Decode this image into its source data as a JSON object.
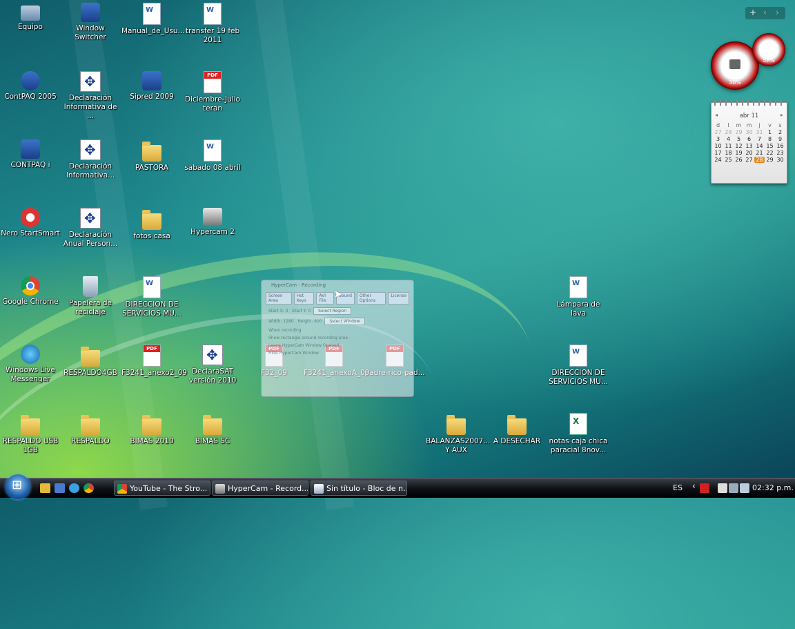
{
  "desktop": {
    "icons": [
      {
        "label": "Equipo",
        "icon": "computer-icon"
      },
      {
        "label": "Window Switcher",
        "icon": "window-switcher-icon"
      },
      {
        "label": "Manual_de_Usu...",
        "icon": "word-document-icon"
      },
      {
        "label": "transfer 19 feb 2011",
        "icon": "word-document-icon"
      },
      {
        "label": "ContPAQ 2005",
        "icon": "contpaq-icon"
      },
      {
        "label": "Declaración Informativa de ...",
        "icon": "sat-app-icon"
      },
      {
        "label": "Sipred 2009",
        "icon": "sipred-icon"
      },
      {
        "label": "Diciembre-Julio teran",
        "icon": "pdf-document-icon"
      },
      {
        "label": "CONTPAQ i",
        "icon": "contpaq-i-icon"
      },
      {
        "label": "Declaración Informativa...",
        "icon": "sat-app-icon"
      },
      {
        "label": "PASTORA",
        "icon": "folder-icon"
      },
      {
        "label": "sabado 08 abril",
        "icon": "word-document-icon"
      },
      {
        "label": "Nero StartSmart",
        "icon": "nero-icon"
      },
      {
        "label": "Declaración Anual Person...",
        "icon": "sat-app-icon"
      },
      {
        "label": "fotos casa",
        "icon": "folder-icon"
      },
      {
        "label": "Hypercam 2",
        "icon": "hypercam-icon"
      },
      {
        "label": "Google Chrome",
        "icon": "chrome-icon"
      },
      {
        "label": "Papelera de reciclaje",
        "icon": "recycle-bin-icon"
      },
      {
        "label": "DIRECCION DE SERVICIOS MU...",
        "icon": "word-document-icon"
      },
      {
        "label": "Lámpara de lava",
        "icon": "word-document-icon"
      },
      {
        "label": "Windows Live Messenger",
        "icon": "messenger-icon"
      },
      {
        "label": "RESPALDO4GB",
        "icon": "folder-icon"
      },
      {
        "label": "F3241_anexo2_09",
        "icon": "pdf-document-icon"
      },
      {
        "label": "DeclaraSAT versión 2010",
        "icon": "sat-app-icon"
      },
      {
        "label": "F32_09",
        "icon": "pdf-document-icon"
      },
      {
        "label": "F3241_anexoA_09",
        "icon": "pdf-document-icon"
      },
      {
        "label": "padre-rico-pad...",
        "icon": "pdf-document-icon"
      },
      {
        "label": "DIRECCION DE SERVICIOS MU...",
        "icon": "word-document-icon"
      },
      {
        "label": "RESPALDO USB 1GB",
        "icon": "folder-icon"
      },
      {
        "label": "RESPALDO",
        "icon": "folder-icon"
      },
      {
        "label": "BIMAS 2010",
        "icon": "folder-icon"
      },
      {
        "label": "BIMAS SC",
        "icon": "folder-icon"
      },
      {
        "label": "BALANZAS2007... Y AUX",
        "icon": "folder-icon"
      },
      {
        "label": "A DESECHAR",
        "icon": "folder-icon"
      },
      {
        "label": "notas caja chica paracial 8nov...",
        "icon": "excel-document-icon"
      }
    ]
  },
  "gadgets": {
    "add_label": "+",
    "cpu_meter": {
      "cpu": "30%",
      "memory": "57%"
    },
    "calendar": {
      "month": "abr 11",
      "weekdays": [
        "d",
        "l",
        "m",
        "m",
        "j",
        "v",
        "s"
      ],
      "weeks": [
        [
          "27",
          "28",
          "29",
          "30",
          "31",
          "1",
          "2"
        ],
        [
          "3",
          "4",
          "5",
          "6",
          "7",
          "8",
          "9"
        ],
        [
          "10",
          "11",
          "12",
          "13",
          "14",
          "15",
          "16"
        ],
        [
          "17",
          "18",
          "19",
          "20",
          "21",
          "22",
          "23"
        ],
        [
          "24",
          "25",
          "26",
          "27",
          "28",
          "29",
          "30"
        ]
      ],
      "today": "28"
    }
  },
  "hypercam_window": {
    "title": "HyperCam - Recording",
    "tabs": [
      "Screen Area",
      "Hot Keys",
      "AVI File",
      "Sound",
      "Other Options",
      "License"
    ],
    "startx_label": "Start X: 0",
    "starty_label": "Start Y: 0",
    "width_label": "Width: 1280",
    "height_label": "Height: 800",
    "select_region": "Select Region",
    "select_window": "Select Window",
    "when_recording": "When recording",
    "opt1": "Show rectangle around recording area",
    "opt2": "Leave HyperCam Window Opened",
    "opt3": "Hide HyperCam Window"
  },
  "taskbar": {
    "tasks": [
      {
        "label": "YouTube - The Stro...",
        "icon": "chrome-icon"
      },
      {
        "label": "HyperCam - Record...",
        "icon": "hypercam-icon"
      },
      {
        "label": "Sin título - Bloc de n...",
        "icon": "notepad-icon"
      }
    ],
    "language": "ES",
    "clock": "02:32 p.m."
  },
  "colors": {
    "accent": "#1d5fa8",
    "taskbar": "#0c0f14",
    "calendar_today": "#e98a20"
  }
}
